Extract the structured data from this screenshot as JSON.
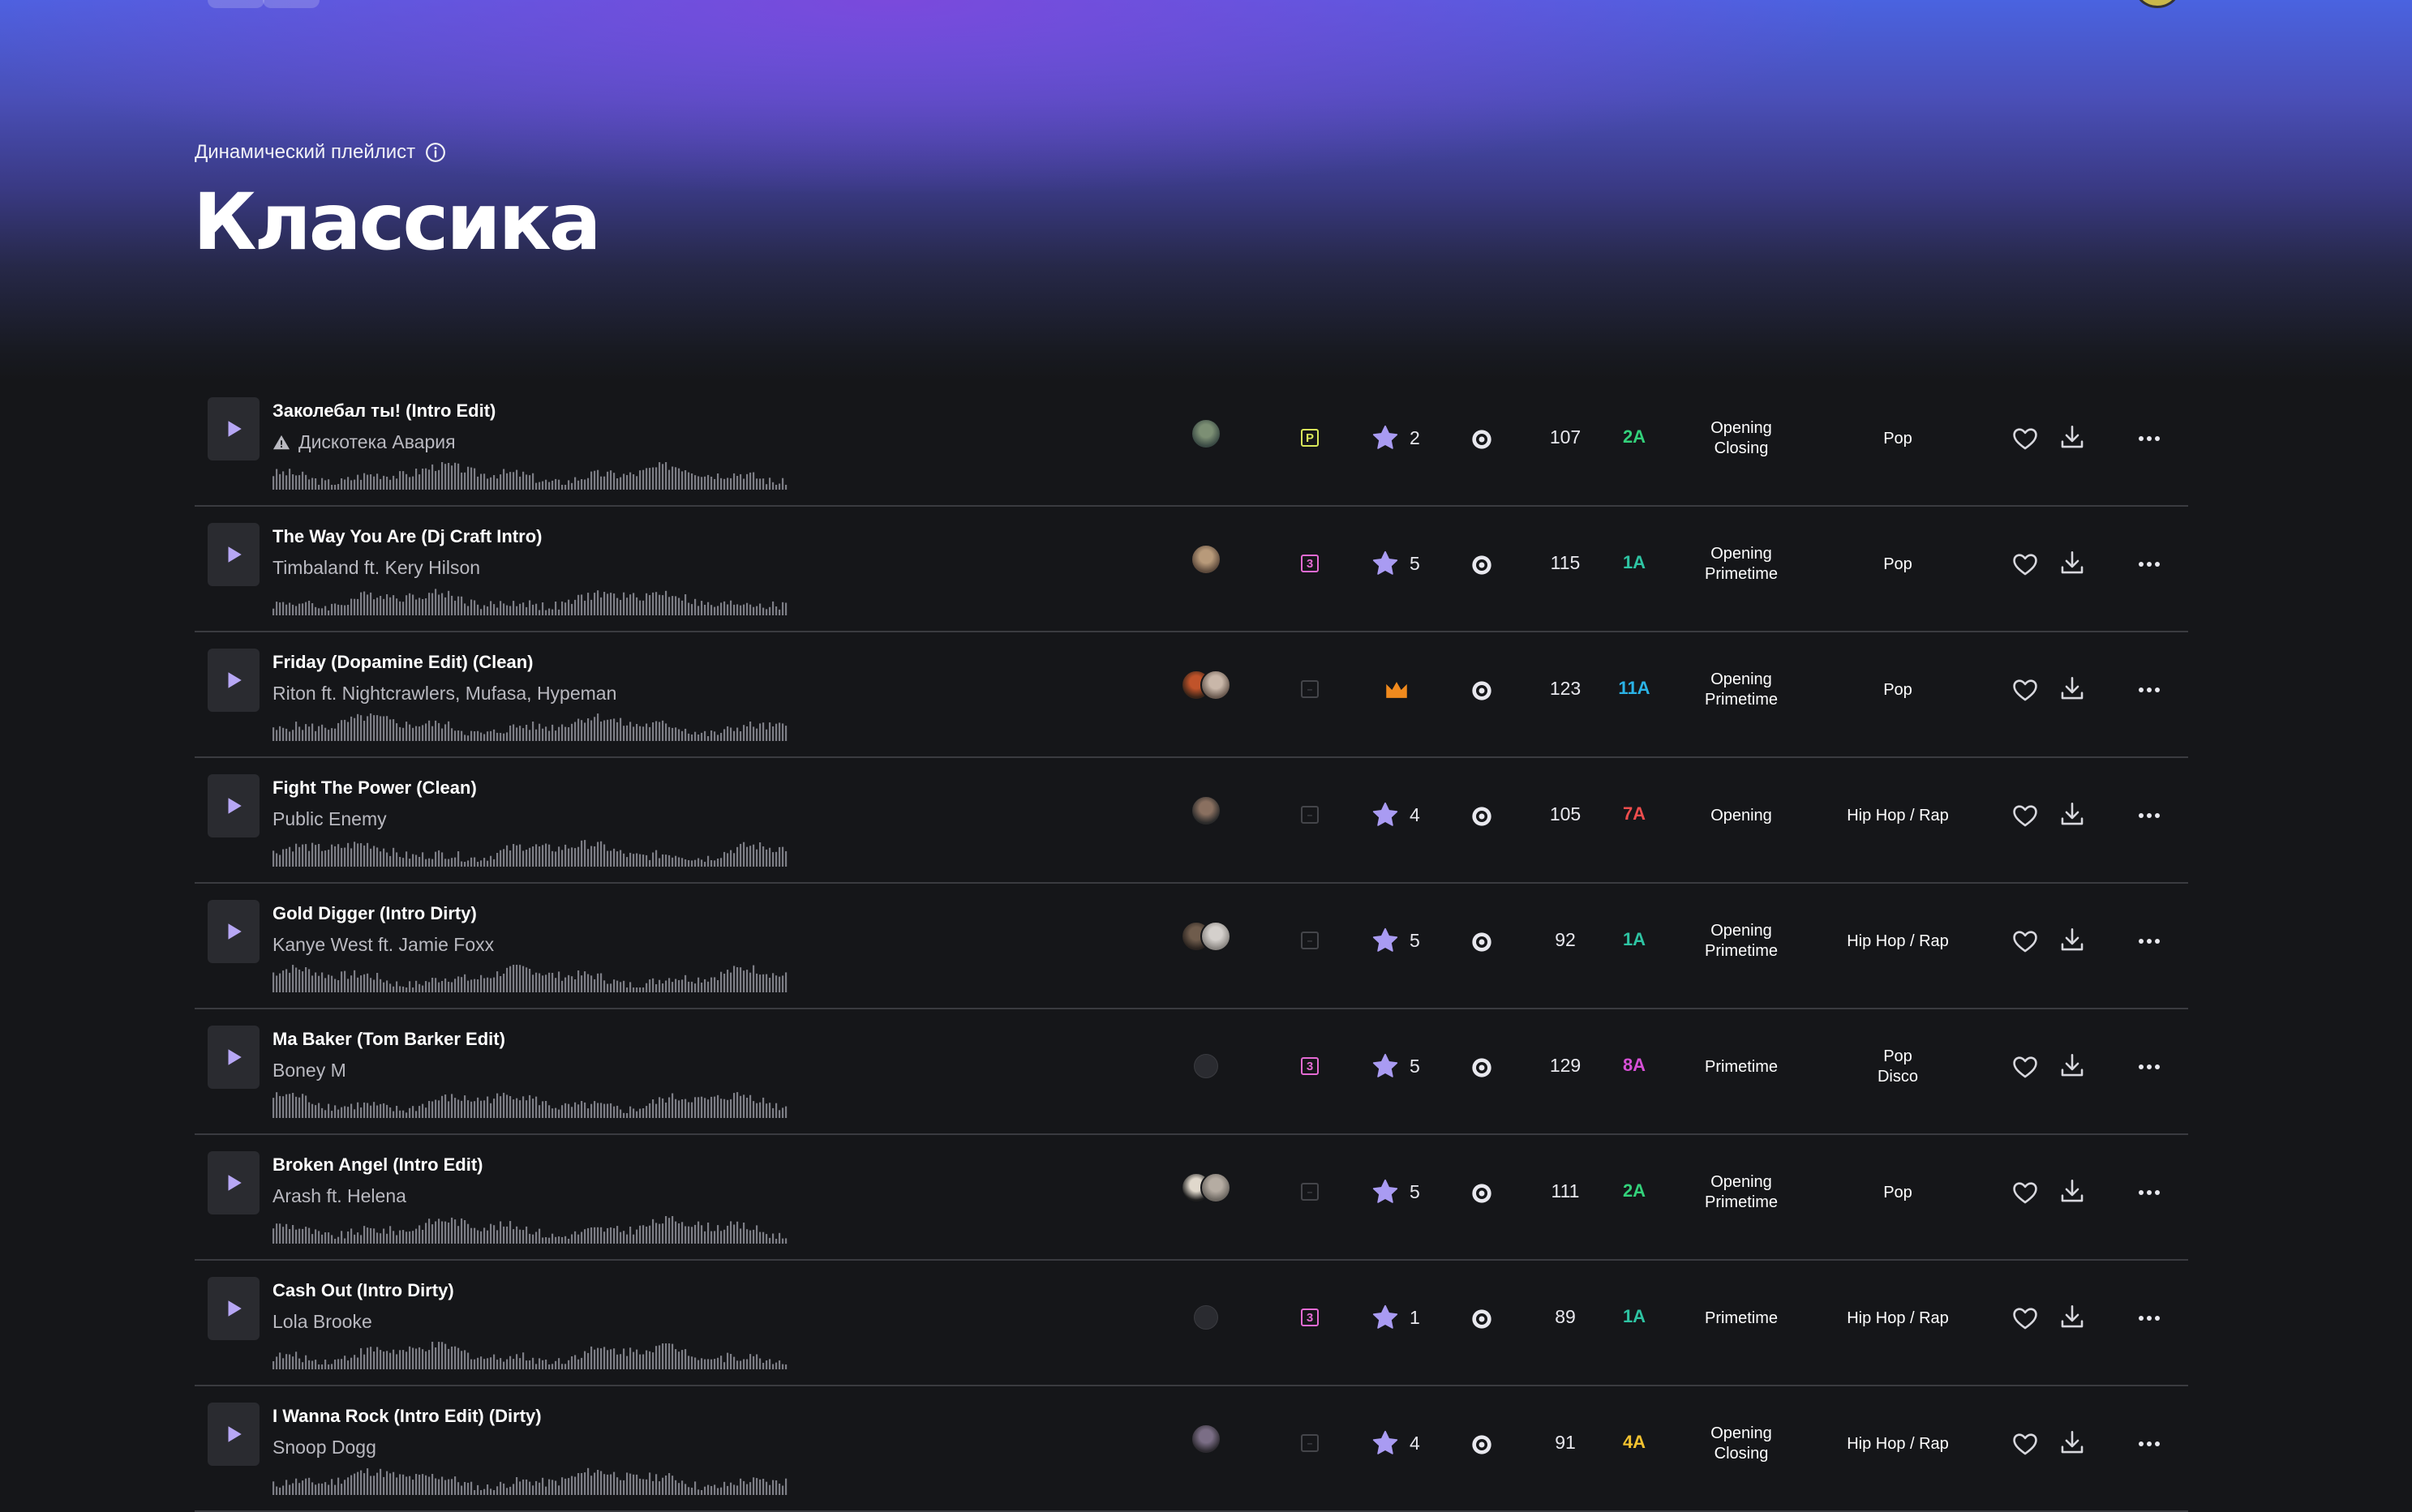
{
  "playlist": {
    "kicker": "Динамический плейлист",
    "title": "Классика"
  },
  "colors": {
    "badge_p": "#d9e85a",
    "badge_3": "#e46bd3",
    "star": "#a99bf2",
    "crown": "#f08a1e"
  },
  "tracks": [
    {
      "title": "Заколебал ты! (Intro Edit)",
      "artist": "Дискотека Авария",
      "warning": true,
      "avatars": [
        [
          "#3a4a44",
          "#7c8f74"
        ]
      ],
      "badge": "P",
      "rating": "2",
      "crown": false,
      "bpm": "107",
      "key": "2A",
      "key_color": "#33d17a",
      "slot": [
        "Opening",
        "Closing"
      ],
      "genre": [
        "Pop"
      ]
    },
    {
      "title": "The Way You Are (Dj Craft Intro)",
      "artist": "Timbaland ft. Kery Hilson",
      "warning": false,
      "avatars": [
        [
          "#5d4a3c",
          "#b89a7a"
        ]
      ],
      "badge": "3",
      "rating": "5",
      "crown": false,
      "bpm": "115",
      "key": "1A",
      "key_color": "#2ec4a3",
      "slot": [
        "Opening",
        "Primetime"
      ],
      "genre": [
        "Pop"
      ]
    },
    {
      "title": "Friday (Dopamine Edit) (Clean)",
      "artist": "Riton ft. Nightcrawlers, Mufasa, Hypeman",
      "warning": false,
      "avatars": [
        [
          "#3a2418",
          "#c0532a"
        ],
        [
          "#6a5a50",
          "#c9b7a9"
        ]
      ],
      "badge": "",
      "rating": "",
      "crown": true,
      "bpm": "123",
      "key": "11A",
      "key_color": "#2bb3e6",
      "slot": [
        "Opening",
        "Primetime"
      ],
      "genre": [
        "Pop"
      ]
    },
    {
      "title": "Fight The Power (Clean)",
      "artist": "Public Enemy",
      "warning": false,
      "avatars": [
        [
          "#2a2a2a",
          "#8a7060"
        ]
      ],
      "badge": "",
      "rating": "4",
      "crown": false,
      "bpm": "105",
      "key": "7A",
      "key_color": "#ee4d4d",
      "slot": [
        "Opening"
      ],
      "genre": [
        "Hip Hop / Rap"
      ]
    },
    {
      "title": "Gold Digger (Intro Dirty)",
      "artist": "Kanye West ft. Jamie Foxx",
      "warning": false,
      "avatars": [
        [
          "#2b2420",
          "#6f5c4c"
        ],
        [
          "#8a8682",
          "#d4d0cc"
        ]
      ],
      "badge": "",
      "rating": "5",
      "crown": false,
      "bpm": "92",
      "key": "1A",
      "key_color": "#2ec4a3",
      "slot": [
        "Opening",
        "Primetime"
      ],
      "genre": [
        "Hip Hop / Rap"
      ]
    },
    {
      "title": "Ma Baker (Tom Barker Edit)",
      "artist": "Boney M",
      "warning": false,
      "avatars": [],
      "badge": "3",
      "rating": "5",
      "crown": false,
      "bpm": "129",
      "key": "8A",
      "key_color": "#d64fd6",
      "slot": [
        "Primetime"
      ],
      "genre": [
        "Pop",
        "Disco"
      ]
    },
    {
      "title": "Broken Angel (Intro Edit)",
      "artist": "Arash ft. Helena",
      "warning": false,
      "avatars": [
        [
          "#1e1e1e",
          "#e0d8cc"
        ],
        [
          "#6b6660",
          "#b5aca2"
        ]
      ],
      "badge": "",
      "rating": "5",
      "crown": false,
      "bpm": "111",
      "key": "2A",
      "key_color": "#33d17a",
      "slot": [
        "Opening",
        "Primetime"
      ],
      "genre": [
        "Pop"
      ]
    },
    {
      "title": "Cash Out (Intro Dirty)",
      "artist": "Lola Brooke",
      "warning": false,
      "avatars": [],
      "badge": "3",
      "rating": "1",
      "crown": false,
      "bpm": "89",
      "key": "1A",
      "key_color": "#2ec4a3",
      "slot": [
        "Primetime"
      ],
      "genre": [
        "Hip Hop / Rap"
      ]
    },
    {
      "title": "I Wanna Rock (Intro Edit) (Dirty)",
      "artist": "Snoop Dogg",
      "warning": false,
      "avatars": [
        [
          "#2d2a30",
          "#7b6e86"
        ]
      ],
      "badge": "",
      "rating": "4",
      "crown": false,
      "bpm": "91",
      "key": "4A",
      "key_color": "#f2c230",
      "slot": [
        "Opening",
        "Closing"
      ],
      "genre": [
        "Hip Hop / Rap"
      ]
    }
  ]
}
